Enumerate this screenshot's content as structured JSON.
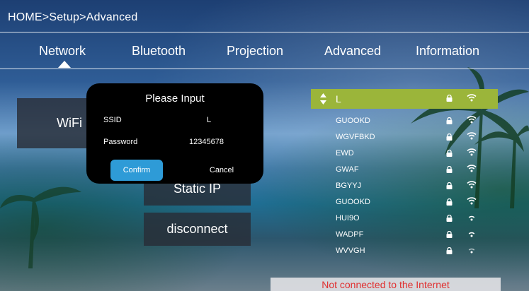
{
  "breadcrumb": "HOME>Setup>Advanced",
  "tabs": [
    {
      "label": "Network"
    },
    {
      "label": "Bluetooth"
    },
    {
      "label": "Projection"
    },
    {
      "label": "Advanced"
    },
    {
      "label": "Information"
    }
  ],
  "left_buttons": {
    "wifi": "WiFi",
    "static_ip": "Static IP",
    "disconnect": "disconnect"
  },
  "dialog": {
    "title": "Please Input",
    "ssid_label": "SSID",
    "ssid_value": "L",
    "password_label": "Password",
    "password_value": "12345678",
    "confirm": "Confirm",
    "cancel": "Cancel"
  },
  "networks": [
    {
      "name": "L"
    },
    {
      "name": "GUOOKD"
    },
    {
      "name": "WGVFBKD"
    },
    {
      "name": "EWD"
    },
    {
      "name": "GWAF"
    },
    {
      "name": "BGYYJ"
    },
    {
      "name": "GUOOKD"
    },
    {
      "name": "HUI9O"
    },
    {
      "name": "WADPF"
    },
    {
      "name": "WVVGH"
    }
  ],
  "status": "Not connected to the Internet",
  "colors": {
    "selected_row": "#9bb53a",
    "confirm_button": "#2e9bd7",
    "status_text": "#e03030"
  },
  "icons": [
    "sort-arrows-icon",
    "lock-icon",
    "wifi-signal-icon"
  ]
}
